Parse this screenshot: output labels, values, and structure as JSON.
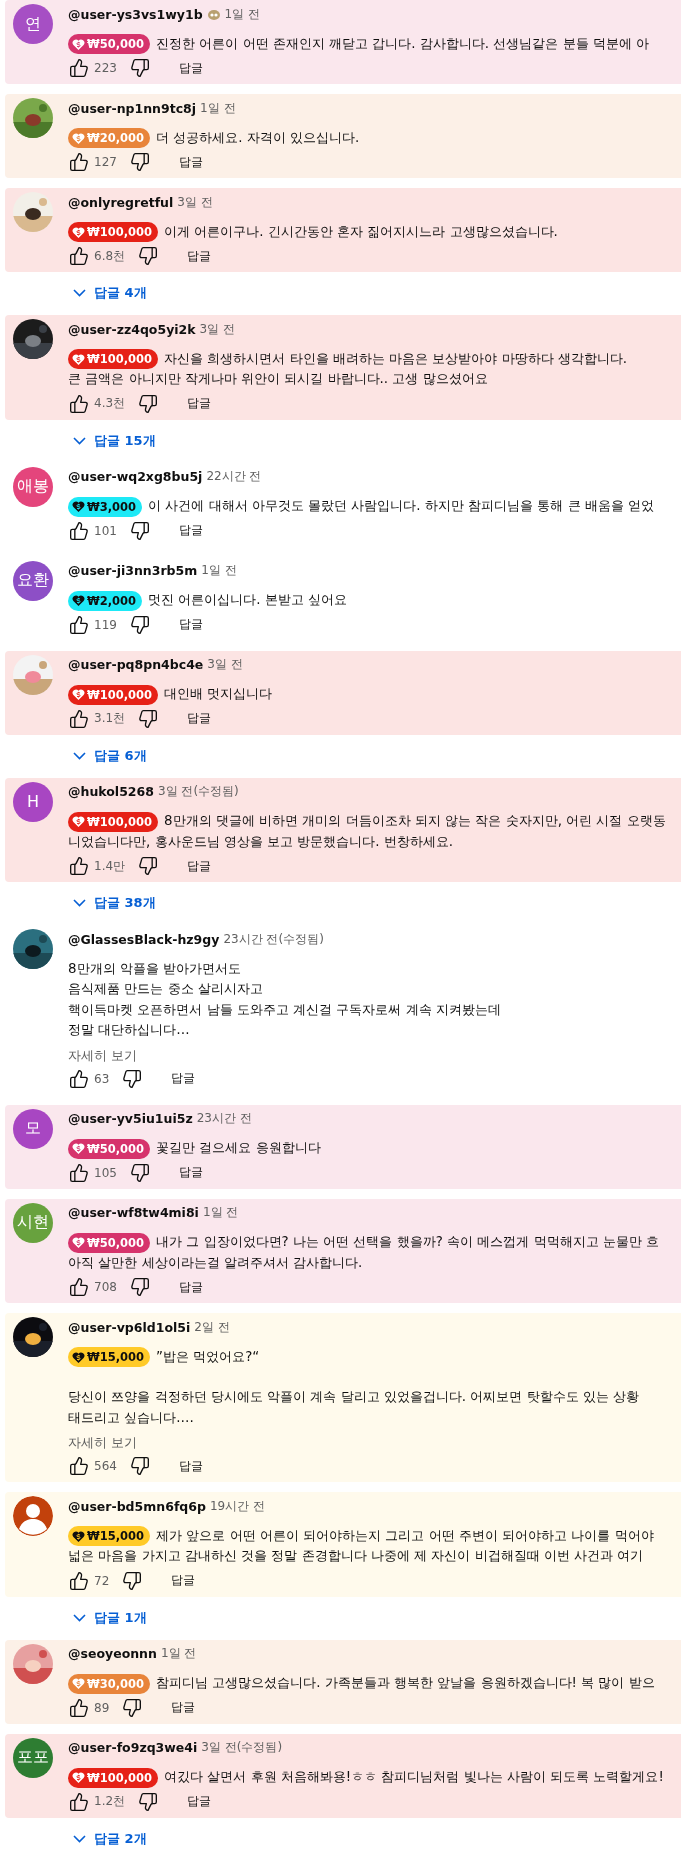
{
  "comments": [
    {
      "avatar": {
        "kind": "initial",
        "text": "연",
        "color": "#a64fc4"
      },
      "handle": "@user-ys3vs1wy1b",
      "member_badge": true,
      "time": "1일 전",
      "donation": {
        "amount": "₩50,000",
        "color": "#d6336c"
      },
      "lines": [
        "진정한 어른이 어떤 존재인지 깨닫고 갑니다. 감사합니다. 선생님같은 분들 덕분에 아"
      ],
      "likes": "223",
      "reply": "답글"
    },
    {
      "avatar": {
        "kind": "picture"
      },
      "handle": "@user-np1nn9tc8j",
      "time": "1일 전",
      "donation": {
        "amount": "₩20,000",
        "color": "#e8843a"
      },
      "lines": [
        "더 성공하세요. 자격이 있으십니다."
      ],
      "likes": "127",
      "reply": "답글"
    },
    {
      "avatar": {
        "kind": "picture"
      },
      "handle": "@onlyregretful",
      "time": "3일 전",
      "donation": {
        "amount": "₩100,000",
        "color": "#e62117"
      },
      "lines": [
        "이게 어른이구나. 긴시간동안 혼자 짊어지시느라 고생많으셨습니다."
      ],
      "likes": "6.8천",
      "reply": "답글",
      "replies": "답글 4개"
    },
    {
      "avatar": {
        "kind": "picture"
      },
      "handle": "@user-zz4qo5yi2k",
      "time": "3일 전",
      "donation": {
        "amount": "₩100,000",
        "color": "#e62117"
      },
      "lines": [
        "자신을 희생하시면서 타인을 배려하는 마음은 보상받아야 마땅하다 생각합니다.",
        "큰 금액은 아니지만 작게나마 위안이 되시길 바랍니다.. 고생 많으셨어요"
      ],
      "likes": "4.3천",
      "reply": "답글",
      "replies": "답글 15개"
    },
    {
      "avatar": {
        "kind": "initial",
        "text": "애봉",
        "color": "#e4457c"
      },
      "handle": "@user-wq2xg8bu5j",
      "time": "22시간 전",
      "donation": {
        "amount": "₩3,000",
        "color": "#1de9f6"
      },
      "lines": [
        "이 사건에 대해서 아무것도 몰랐던 사람입니다. 하지만 참피디님을 통해 큰 배움을 얻었"
      ],
      "likes": "101",
      "reply": "답글"
    },
    {
      "avatar": {
        "kind": "initial",
        "text": "요환",
        "color": "#8d4fc6"
      },
      "handle": "@user-ji3nn3rb5m",
      "time": "1일 전",
      "donation": {
        "amount": "₩2,000",
        "color": "#1de9f6"
      },
      "lines": [
        "멋진 어른이십니다. 본받고 싶어요"
      ],
      "likes": "119",
      "reply": "답글"
    },
    {
      "avatar": {
        "kind": "picture"
      },
      "handle": "@user-pq8pn4bc4e",
      "time": "3일 전",
      "donation": {
        "amount": "₩100,000",
        "color": "#e62117"
      },
      "lines": [
        "대인배 멋지십니다"
      ],
      "likes": "3.1천",
      "reply": "답글",
      "replies": "답글 6개"
    },
    {
      "avatar": {
        "kind": "initial",
        "text": "H",
        "color": "#a846c2"
      },
      "handle": "@hukol5268",
      "time": "3일 전(수정됨)",
      "donation": {
        "amount": "₩100,000",
        "color": "#e62117"
      },
      "lines": [
        "8만개의 댓글에 비하면 개미의 더듬이조차 되지 않는 작은 숫자지만, 어린 시절 오랫동",
        "니었습니다만, 홍사운드님 영상을 보고 방문했습니다. 번창하세요."
      ],
      "likes": "1.4만",
      "reply": "답글",
      "replies": "답글 38개"
    },
    {
      "avatar": {
        "kind": "picture"
      },
      "handle": "@GlassesBlack-hz9gy",
      "time": "23시간 전(수정됨)",
      "lines": [
        "8만개의 악플을 받아가면서도",
        "음식제품 만드는 중소 살리시자고",
        "핵이득마켓 오픈하면서 남들 도와주고 계신걸 구독자로써 계속 지켜봤는데",
        "정말 대단하십니다…"
      ],
      "more": "자세히 보기",
      "likes": "63",
      "reply": "답글"
    },
    {
      "avatar": {
        "kind": "initial",
        "text": "모",
        "color": "#a846c2"
      },
      "handle": "@user-yv5iu1ui5z",
      "time": "23시간 전",
      "donation": {
        "amount": "₩50,000",
        "color": "#d6336c"
      },
      "lines": [
        "꽃길만 걸으세요 응원합니다"
      ],
      "likes": "105",
      "reply": "답글"
    },
    {
      "avatar": {
        "kind": "initial",
        "text": "시현",
        "color": "#68a23e"
      },
      "handle": "@user-wf8tw4mi8i",
      "time": "1일 전",
      "donation": {
        "amount": "₩50,000",
        "color": "#d6336c"
      },
      "lines": [
        "내가 그 입장이었다면? 나는 어떤 선택을 했을까? 속이 메스껍게 먹먹해지고 눈물만 흐",
        "아직 살만한 세상이라는걸 알려주셔서 감사합니다."
      ],
      "likes": "708",
      "reply": "답글"
    },
    {
      "avatar": {
        "kind": "picture"
      },
      "handle": "@user-vp6ld1ol5i",
      "time": "2일 전",
      "donation": {
        "amount": "₩15,000",
        "color": "#ffca28"
      },
      "lines": [
        "”밥은 먹었어요?“"
      ],
      "lines_2": [
        "당신이 쯔양을 걱정하던 당시에도 악플이 계속 달리고 있었을겁니다. 어찌보면 탓할수도 있는 상황",
        "태드리고 싶습니다.…"
      ],
      "more": "자세히 보기",
      "likes": "564",
      "reply": "답글"
    },
    {
      "avatar": {
        "kind": "silhouette",
        "color": "#c2410c"
      },
      "handle": "@user-bd5mn6fq6p",
      "time": "19시간 전",
      "donation": {
        "amount": "₩15,000",
        "color": "#ffca28"
      },
      "lines": [
        "제가 앞으로 어떤 어른이 되어야하는지 그리고 어떤 주변이 되어야하고 나이를 먹어야",
        "넓은 마음을 가지고 감내하신 것을 정말 존경합니다 나중에 제 자신이 비겁해질때 이번 사건과 여기"
      ],
      "likes": "72",
      "reply": "답글",
      "replies": "답글 1개"
    },
    {
      "avatar": {
        "kind": "picture"
      },
      "handle": "@seoyeonnn",
      "time": "1일 전",
      "donation": {
        "amount": "₩30,000",
        "color": "#e8843a"
      },
      "lines": [
        "참피디님 고생많으셨습니다. 가족분들과 행복한 앞날을 응원하겠습니다! 복 많이 받으"
      ],
      "likes": "89",
      "reply": "답글"
    },
    {
      "avatar": {
        "kind": "initial",
        "text": "포포",
        "color": "#2e7d32"
      },
      "handle": "@user-fo9zq3we4i",
      "time": "3일 전(수정됨)",
      "donation": {
        "amount": "₩100,000",
        "color": "#e62117"
      },
      "lines": [
        "여깄다 살면서 후원 처음해봐용!ㅎㅎ 참피디님처럼 빛나는 사람이 되도록 노력할게요!"
      ],
      "likes": "1.2천",
      "reply": "답글",
      "replies": "답글 2개"
    }
  ]
}
